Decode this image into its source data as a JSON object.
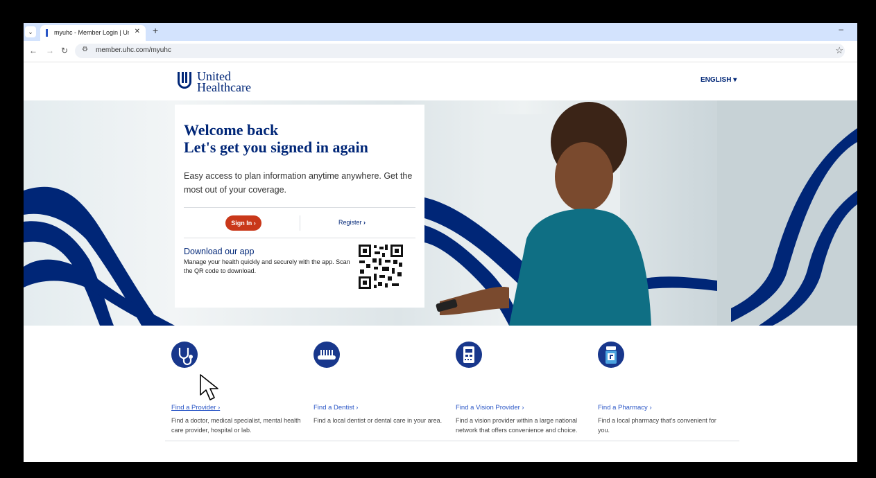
{
  "browser": {
    "tab_title": "myuhc - Member Login | United",
    "tab_close": "✕",
    "new_tab": "+",
    "url": "member.uhc.com/myuhc",
    "minimize": "–"
  },
  "header": {
    "logo_line1": "United",
    "logo_line2": "Healthcare",
    "language": "ENGLISH"
  },
  "hero": {
    "title_line1": "Welcome back",
    "title_line2": "Let's get you signed in again",
    "description": "Easy access to plan information anytime anywhere. Get the most out of your coverage.",
    "signin_label": "Sign In",
    "register_label": "Register",
    "download_title": "Download our app",
    "download_desc": "Manage your health quickly and securely with the app. Scan the QR code to download."
  },
  "features": [
    {
      "icon": "stethoscope-icon",
      "link": "Find a Provider",
      "text": "Find a doctor, medical specialist, mental health care provider, hospital or lab."
    },
    {
      "icon": "toothbrush-icon",
      "link": "Find a Dentist",
      "text": "Find a local dentist or dental care in your area."
    },
    {
      "icon": "eye-chart-icon",
      "link": "Find a Vision Provider",
      "text": "Find a vision provider within a large national network that offers convenience and choice."
    },
    {
      "icon": "pill-bottle-icon",
      "link": "Find a Pharmacy",
      "text": "Find a local pharmacy that's convenient for you."
    }
  ],
  "colors": {
    "brand_blue": "#002677",
    "signin_orange": "#c9381a",
    "link_blue": "#2a56c6",
    "icon_circle": "#18378c"
  }
}
